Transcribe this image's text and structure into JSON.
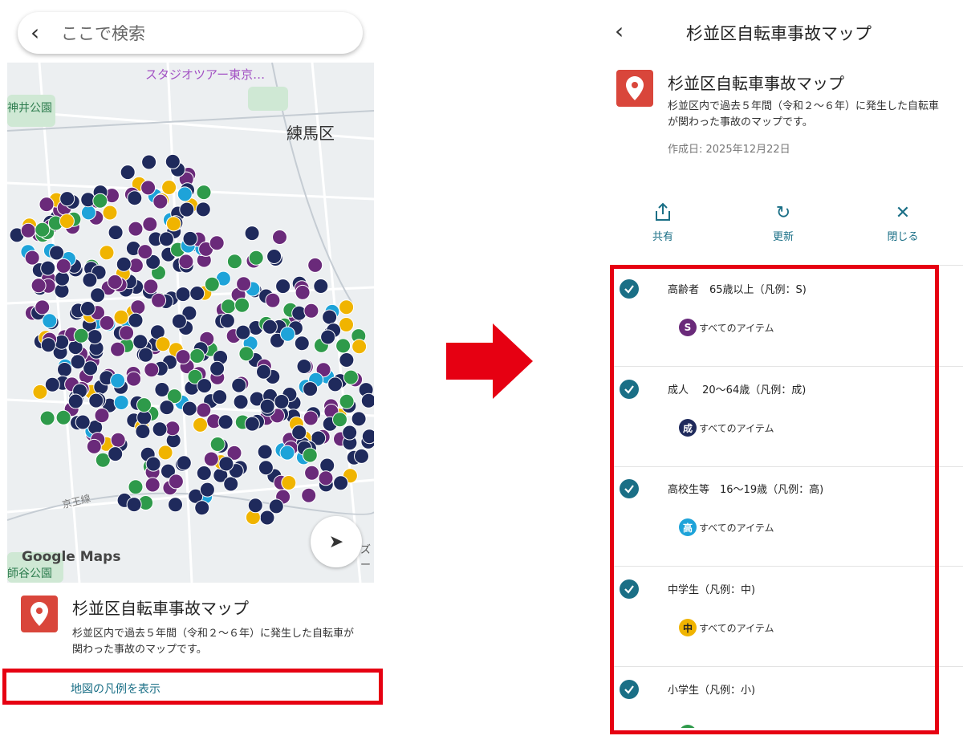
{
  "left": {
    "search": {
      "placeholder": "ここで検索",
      "back_icon": "chevron-left-icon"
    },
    "map": {
      "district_label": "練馬区",
      "poi_label": "スタジオツアー東京…",
      "park_label_top": "神井公園",
      "park_label_bottom": "師谷公園",
      "rail_label": "京王線",
      "right_edge_label": "ズー・",
      "logo": "Google Maps",
      "locate_icon": "location-arrow-icon",
      "marker_colors": {
        "S": "#6a2a7a",
        "成": "#1f2a5c",
        "高": "#1ea3d9",
        "中": "#f0b400",
        "小": "#2e9a4a"
      }
    },
    "card": {
      "title": "杉並区自転車事故マップ",
      "description": "杉並区内で過去５年間（令和２～６年）に発生した自転車が関わった事故のマップです。",
      "legend_link": "地図の凡例を表示"
    }
  },
  "right": {
    "header": {
      "title": "杉並区自転車事故マップ"
    },
    "card": {
      "title": "杉並区自転車事故マップ",
      "description": "杉並区内で過去５年間（令和２～６年）に発生した自転車が関わった事故のマップです。",
      "date": "作成日: 2025年12月22日"
    },
    "actions": [
      {
        "label": "共有",
        "icon": "share-icon"
      },
      {
        "label": "更新",
        "icon": "refresh-icon"
      },
      {
        "label": "閉じる",
        "icon": "close-icon"
      }
    ],
    "layers": [
      {
        "name": "高齢者　65歳以上（凡例：S)",
        "badge": "S",
        "color": "#6a2a7a",
        "item": "すべてのアイテム"
      },
      {
        "name": "成人　 20～64歳（凡例：成)",
        "badge": "成",
        "color": "#1f2a5c",
        "item": "すべてのアイテム"
      },
      {
        "name": "高校生等　16～19歳（凡例：高)",
        "badge": "高",
        "color": "#1ea3d9",
        "item": "すべてのアイテム"
      },
      {
        "name": "中学生（凡例：中)",
        "badge": "中",
        "color": "#f0b400",
        "item": "すべてのアイテム"
      },
      {
        "name": "小学生（凡例：小)",
        "badge": "",
        "color": "#2e9a4a",
        "item": ""
      }
    ]
  },
  "highlight_color": "#e60012",
  "accent_color": "#1a6f86",
  "pin_color": "#d9463b"
}
